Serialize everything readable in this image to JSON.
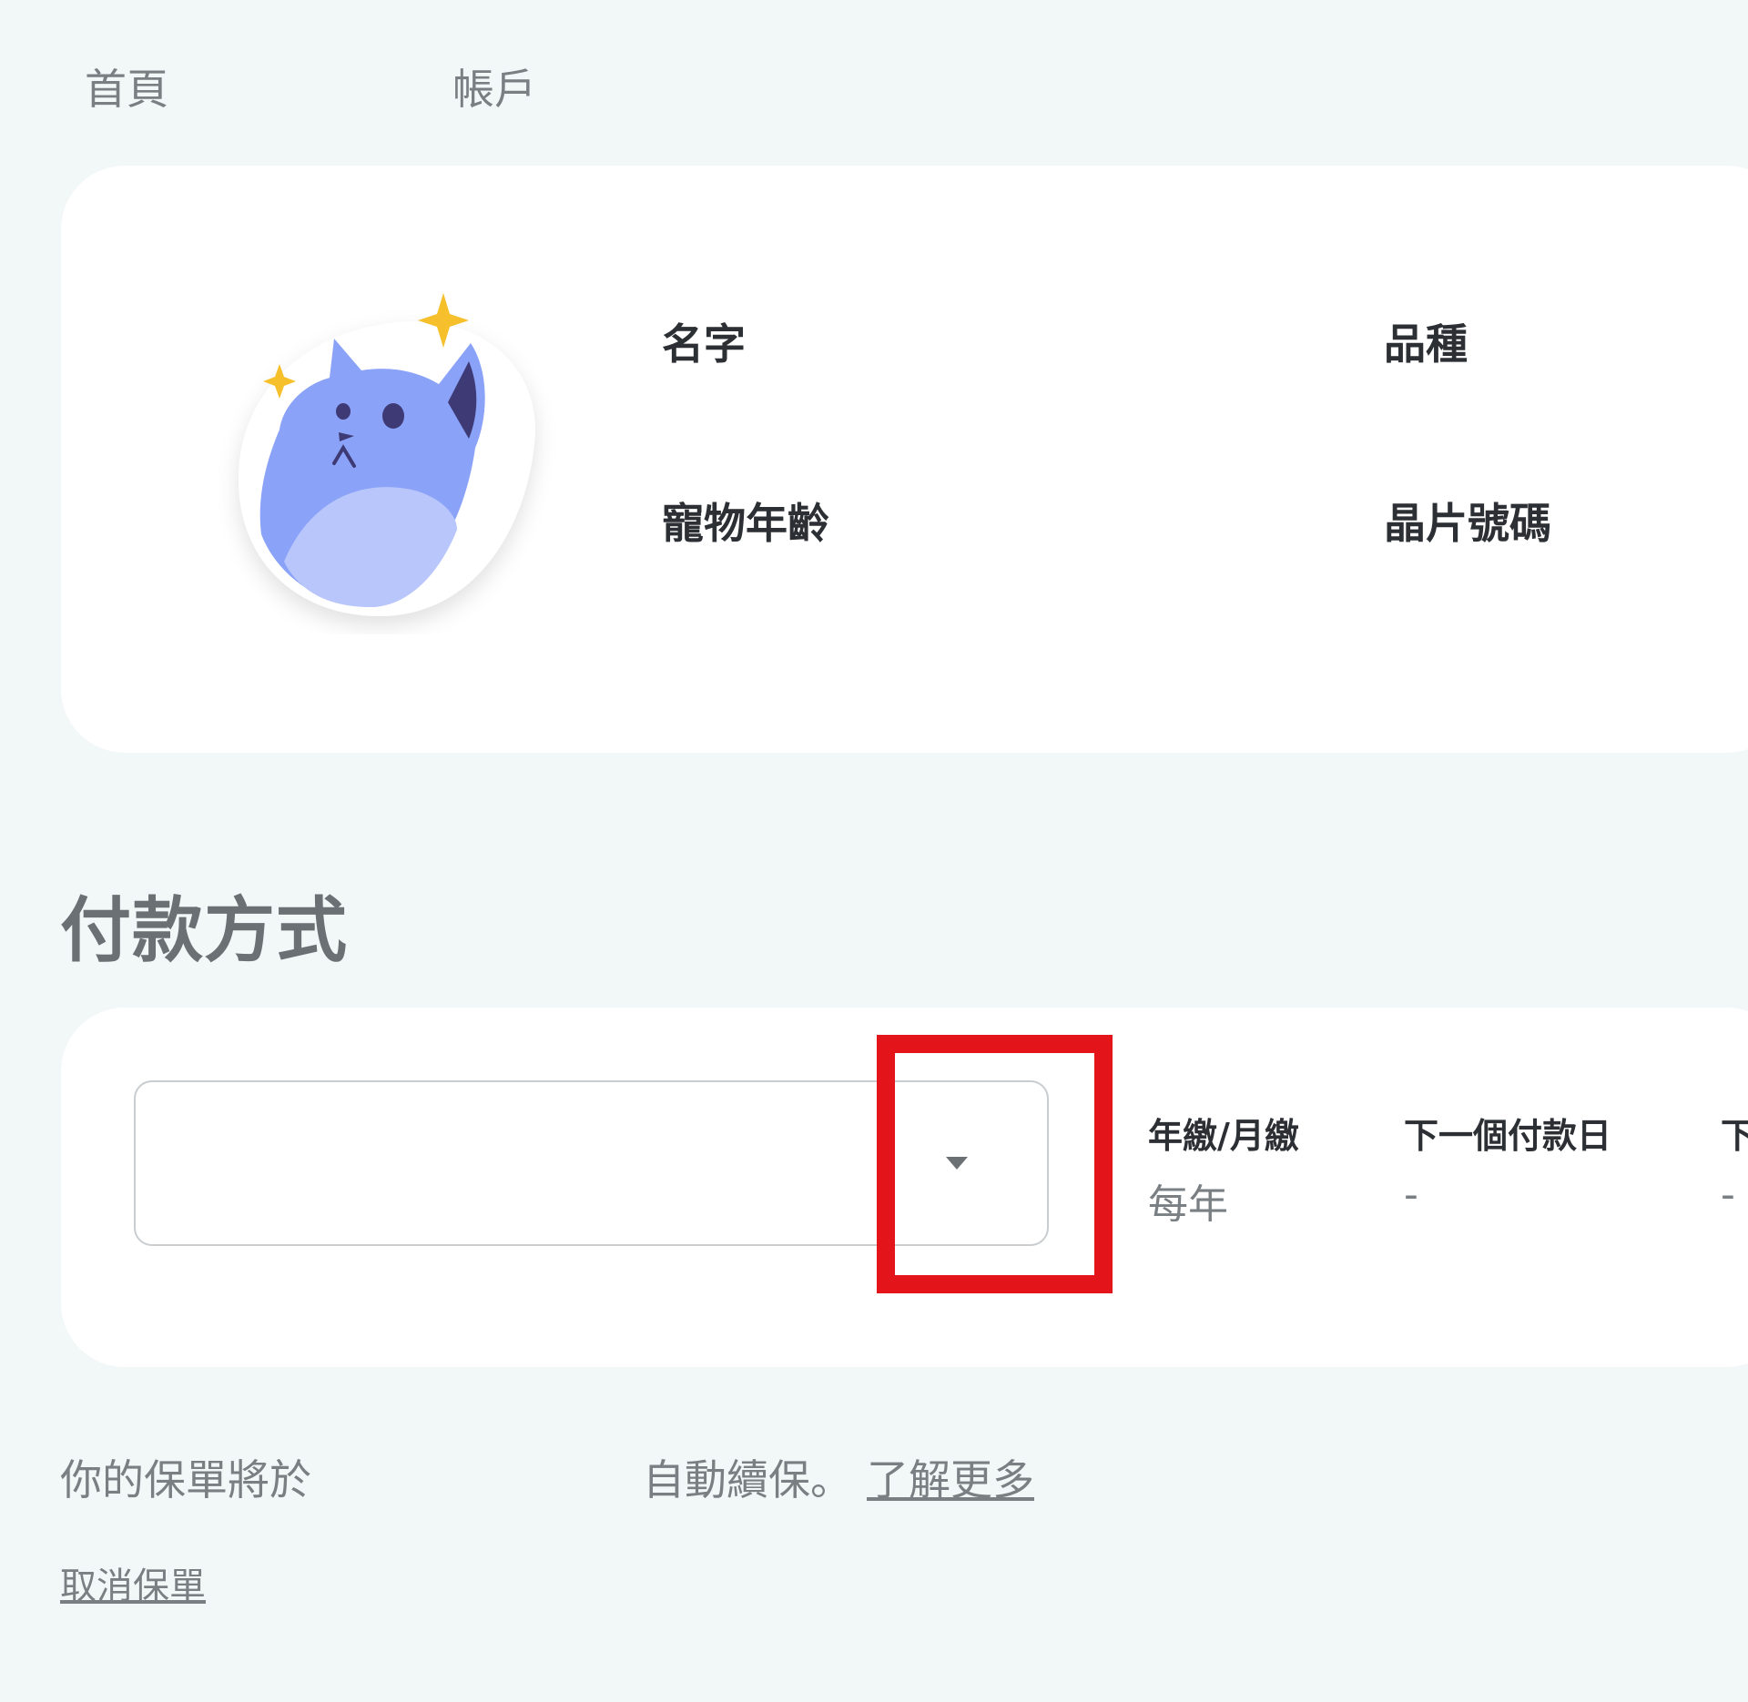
{
  "nav": {
    "home_label": "首頁",
    "account_label": "帳戶"
  },
  "pet_card": {
    "avatar_icon": "cat-avatar-icon",
    "name_label": "名字",
    "breed_label": "品種",
    "age_label": "寵物年齡",
    "chip_label": "晶片號碼"
  },
  "payment": {
    "title": "付款方式",
    "select_value": "",
    "frequency_label": "年繳/月繳",
    "frequency_value": "每年",
    "next_payment_label": "下一個付款日",
    "next_payment_value": "-",
    "third_label_partial": "下",
    "third_value": "-"
  },
  "footer": {
    "renew_prefix": "你的保單將於",
    "renew_suffix": "自動續保。",
    "learn_more": "了解更多",
    "cancel_policy": "取消保單"
  },
  "colors": {
    "page_bg": "#f2f7f7",
    "card_bg": "#ffffff",
    "highlight": "#e3141a",
    "cat_blue": "#8aa2f7",
    "sparkle": "#f5c02b"
  }
}
